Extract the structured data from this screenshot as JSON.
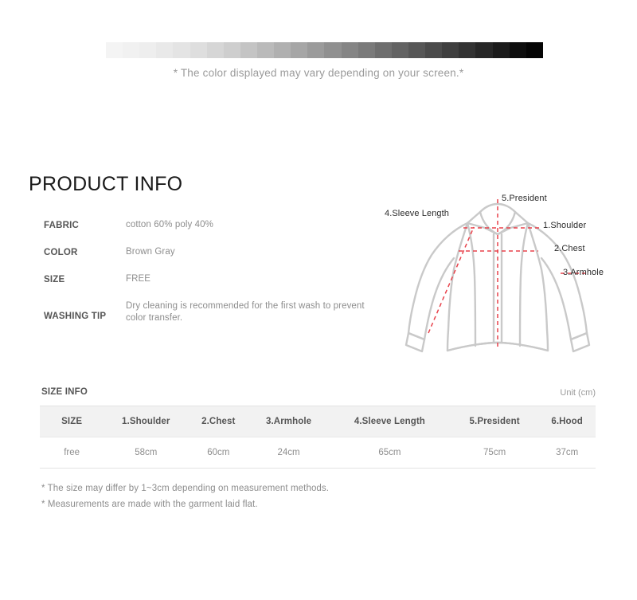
{
  "color_swatch": {
    "disclaimer": "* The color displayed may vary depending on your screen.*",
    "swatches": [
      "#f4f4f4",
      "#f1f1f1",
      "#eeeeee",
      "#e9e9e9",
      "#e4e4e4",
      "#dedede",
      "#d6d6d6",
      "#cecece",
      "#c4c4c4",
      "#bababa",
      "#b0b0b0",
      "#a6a6a6",
      "#9b9b9b",
      "#909090",
      "#858585",
      "#7a7a7a",
      "#6e6e6e",
      "#636363",
      "#575757",
      "#4b4b4b",
      "#3f3f3f",
      "#333333",
      "#272727",
      "#1b1b1b",
      "#0e0e0e",
      "#050505"
    ]
  },
  "product_info": {
    "title": "PRODUCT INFO",
    "specs": [
      {
        "label": "FABRIC",
        "value": "cotton 60% poly 40%"
      },
      {
        "label": "COLOR",
        "value": "Brown Gray"
      },
      {
        "label": "SIZE",
        "value": "FREE"
      },
      {
        "label": "WASHING TIP",
        "value": "Dry cleaning is recommended for the first wash to prevent color transfer."
      }
    ]
  },
  "diagram": {
    "labels": {
      "president": "5.President",
      "sleeve_length": "4.Sleeve Length",
      "shoulder": "1.Shoulder",
      "chest": "2.Chest",
      "armhole": "3.Armhole"
    },
    "colors": {
      "garment_line": "#c9c9c9",
      "measure_line": "#e8414a"
    }
  },
  "size_info": {
    "label": "SIZE INFO",
    "unit": "Unit (cm)",
    "columns": [
      "SIZE",
      "1.Shoulder",
      "2.Chest",
      "3.Armhole",
      "4.Sleeve Length",
      "5.President",
      "6.Hood"
    ],
    "rows": [
      [
        "free",
        "58cm",
        "60cm",
        "24cm",
        "65cm",
        "75cm",
        "37cm"
      ]
    ],
    "notes": [
      "* The size may differ by 1~3cm depending on measurement methods.",
      "* Measurements are made with the garment laid flat."
    ]
  }
}
